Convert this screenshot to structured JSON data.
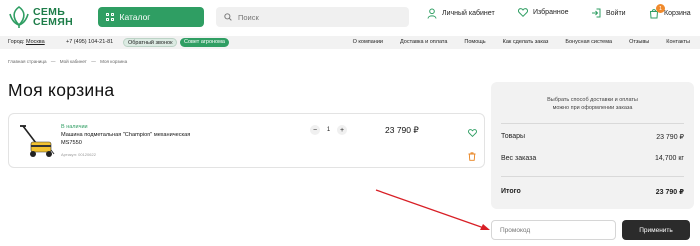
{
  "header": {
    "logo_line1": "СЕМЬ",
    "logo_line2": "СЕМЯН",
    "catalog_label": "Каталог",
    "search_placeholder": "Поиск",
    "account_label": "Личный кабинет",
    "favorites_label": "Избранное",
    "login_label": "Войти",
    "cart_label": "Корзина",
    "cart_count": "1"
  },
  "navbar": {
    "city_prefix": "Город:",
    "city_name": "Москва",
    "phone": "+7 (495) 104-21-81",
    "callback_label": "Обратный звонок",
    "agronomist_label": "Совет агронома",
    "links": [
      "О компании",
      "Доставка и оплата",
      "Помощь",
      "Как сделать заказ",
      "Бонусная система",
      "Отзывы",
      "Контакты"
    ]
  },
  "breadcrumb": [
    "Главная страница",
    "—",
    "Мой кабинет",
    "—",
    "Моя корзина"
  ],
  "page_title": "Моя корзина",
  "item": {
    "stock": "В наличии",
    "name": "Машина подметальная \"Champion\" механическая MS7550",
    "article": "Артикул: 00120622",
    "quantity": "1",
    "price": "23 790 ₽"
  },
  "summary": {
    "note_line1": "Выбрать способ доставки и оплаты",
    "note_line2": "можно при оформлении заказа",
    "goods_label": "Товары",
    "goods_value": "23 790 ₽",
    "weight_label": "Вес заказа",
    "weight_value": "14,700 кг",
    "total_label": "Итого",
    "total_value": "23 790 ₽"
  },
  "promo": {
    "placeholder": "Промокод",
    "apply_label": "Применить"
  },
  "colors": {
    "brand_green": "#2f9e63",
    "badge_orange": "#f08a2c",
    "annotation_arrow": "#d81f26"
  }
}
